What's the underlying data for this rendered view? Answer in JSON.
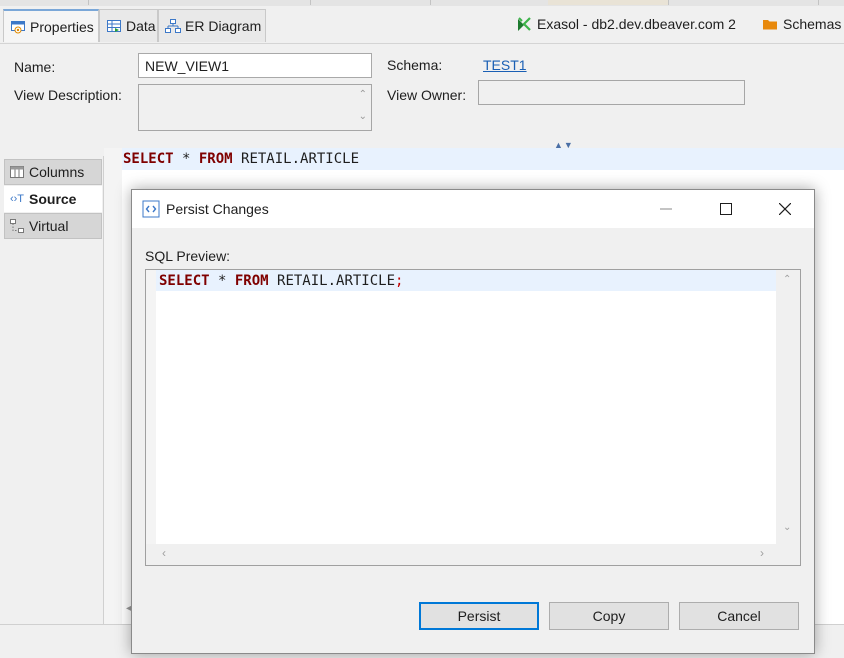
{
  "tabs": {
    "properties": "Properties",
    "data": "Data",
    "er_diagram": "ER Diagram"
  },
  "connection": {
    "name": "Exasol - db2.dev.dbeaver.com 2",
    "schemas_label": "Schemas"
  },
  "properties": {
    "name_label": "Name:",
    "name_value": "NEW_VIEW1",
    "schema_label": "Schema:",
    "schema_value": "TEST1",
    "description_label": "View Description:",
    "owner_label": "View Owner:"
  },
  "side_tabs": {
    "columns": "Columns",
    "source": "Source",
    "virtual": "Virtual"
  },
  "editor": {
    "line1": {
      "kw1": "SELECT",
      "star": " * ",
      "kw2": "FROM",
      "rest": " RETAIL.ARTICLE"
    }
  },
  "dialog": {
    "title": "Persist Changes",
    "sql_preview_label": "SQL Preview:",
    "sql": {
      "kw1": "SELECT",
      "star": " * ",
      "kw2": "FROM",
      "rest": " RETAIL.ARTICLE",
      "semicolon": ";"
    },
    "buttons": {
      "persist": "Persist",
      "copy": "Copy",
      "cancel": "Cancel"
    }
  },
  "colors": {
    "keyword": "#7f0000",
    "link": "#1a5fb4",
    "default_button_border": "#0078d7"
  }
}
